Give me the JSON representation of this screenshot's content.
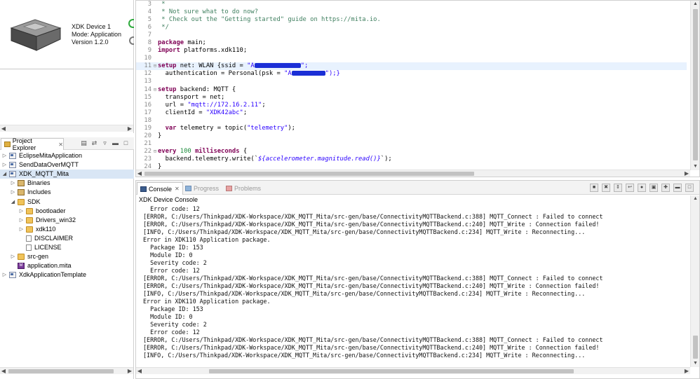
{
  "device": {
    "name": "XDK Device 1",
    "mode": "Mode: Application",
    "version": "Version 1.2.0"
  },
  "project_explorer": {
    "tab_label": "Project Explorer",
    "close_glyph": "✕",
    "items": [
      {
        "label": "EclipseMitaApplication",
        "icon": "project-icon",
        "expanded": false
      },
      {
        "label": "SendDataOverMQTT",
        "icon": "project-icon",
        "expanded": false
      },
      {
        "label": "XDK_MQTT_Mita",
        "icon": "project-icon",
        "expanded": true,
        "selected": true
      },
      {
        "label": "Binaries",
        "icon": "binaries-icon",
        "expanded": false
      },
      {
        "label": "Includes",
        "icon": "includes-icon",
        "expanded": false
      },
      {
        "label": "SDK",
        "icon": "folder-icon",
        "expanded": true
      },
      {
        "label": "bootloader",
        "icon": "folder-icon",
        "expanded": false
      },
      {
        "label": "Drivers_win32",
        "icon": "folder-icon",
        "expanded": false
      },
      {
        "label": "xdk110",
        "icon": "folder-icon",
        "expanded": false
      },
      {
        "label": "DISCLAIMER",
        "icon": "file-icon"
      },
      {
        "label": "LICENSE",
        "icon": "file-icon"
      },
      {
        "label": "src-gen",
        "icon": "folder-icon",
        "expanded": false
      },
      {
        "label": "application.mita",
        "icon": "mita-file-icon"
      },
      {
        "label": "XdkApplicationTemplate",
        "icon": "project-icon",
        "expanded": false
      }
    ]
  },
  "editor": {
    "lines": [
      {
        "n": "3",
        "text": " *"
      },
      {
        "n": "4",
        "text": " * Not sure what to do now?"
      },
      {
        "n": "5",
        "text": " * Check out the \"Getting started\" guide on https://mita.io."
      },
      {
        "n": "6",
        "text": " */"
      },
      {
        "n": "7",
        "text": ""
      },
      {
        "n": "8",
        "text": "package main;"
      },
      {
        "n": "9",
        "text": "import platforms.xdk110;"
      },
      {
        "n": "10",
        "text": ""
      },
      {
        "n": "11",
        "text": "setup net: WLAN {ssid = \"A"
      },
      {
        "n": "12",
        "text": "  authentication = Personal(psk = \"A"
      },
      {
        "n": "13",
        "text": ""
      },
      {
        "n": "14",
        "text": "setup backend: MQTT {"
      },
      {
        "n": "15",
        "text": "  transport = net;"
      },
      {
        "n": "16",
        "text": "  url = \"mqtt://172.16.2.11\";"
      },
      {
        "n": "17",
        "text": "  clientId = \"XDK42abc\";"
      },
      {
        "n": "18",
        "text": ""
      },
      {
        "n": "19",
        "text": "  var telemetry = topic(\"telemetry\");"
      },
      {
        "n": "20",
        "text": "}"
      },
      {
        "n": "21",
        "text": ""
      },
      {
        "n": "22",
        "text": "every 100 milliseconds {"
      },
      {
        "n": "23",
        "text": "  backend.telemetry.write(`${accelerometer.magnitude.read()}`);"
      },
      {
        "n": "24",
        "text": "}"
      }
    ],
    "tokens": {
      "kw_setup": "setup",
      "kw_package": "package",
      "kw_import": "import",
      "kw_var": "var",
      "kw_every": "every",
      "num_100": "100",
      "kw_milliseconds": "milliseconds",
      "line11_rest": " net: WLAN {ssid = ",
      "line11_str_open": "\"A",
      "line11_str_close": "\";",
      "line12_pre": "  authentication = Personal(psk = ",
      "line12_str_open": "\"A",
      "line12_str_close": "\");}",
      "line3": " *",
      "line4": " * Not sure what to do now?",
      "line5": " * Check out the \"Getting started\" guide on https://mita.io.",
      "line6": " */",
      "line8_rest": " main;",
      "line9_rest": " platforms.xdk110;",
      "line14_rest": " backend: MQTT {",
      "line15": "  transport = net;",
      "line16_pre": "  url = ",
      "line16_str": "\"mqtt://172.16.2.11\"",
      "line16_post": ";",
      "line17_pre": "  clientId = ",
      "line17_str": "\"XDK42abc\"",
      "line17_post": ";",
      "line19_pre": "  ",
      "line19_mid": " telemetry = topic(",
      "line19_str": "\"telemetry\"",
      "line19_post": ");",
      "line20": "}",
      "line22_post": " {",
      "line23_pre": "  backend.telemetry.write(`",
      "line23_tpl": "${accelerometer.magnitude.read()}",
      "line23_post": "`);",
      "line24": "}"
    }
  },
  "console": {
    "tabs": [
      {
        "label": "Console",
        "active": true
      },
      {
        "label": "Progress",
        "active": false
      },
      {
        "label": "Problems",
        "active": false
      }
    ],
    "title": "XDK Device Console",
    "lines": [
      "  Error code: 12",
      "[ERROR, C:/Users/Thinkpad/XDK-Workspace/XDK_MQTT_Mita/src-gen/base/ConnectivityMQTTBackend.c:388] MQTT_Connect : Failed to connect",
      "[ERROR, C:/Users/Thinkpad/XDK-Workspace/XDK_MQTT_Mita/src-gen/base/ConnectivityMQTTBackend.c:240] MQTT_Write : Connection failed!",
      "[INFO, C:/Users/Thinkpad/XDK-Workspace/XDK_MQTT_Mita/src-gen/base/ConnectivityMQTTBackend.c:234] MQTT_Write : Reconnecting...",
      "Error in XDK110 Application package.",
      "  Package ID: 153",
      "  Module ID: 0",
      "  Severity code: 2",
      "  Error code: 12",
      "[ERROR, C:/Users/Thinkpad/XDK-Workspace/XDK_MQTT_Mita/src-gen/base/ConnectivityMQTTBackend.c:388] MQTT_Connect : Failed to connect",
      "[ERROR, C:/Users/Thinkpad/XDK-Workspace/XDK_MQTT_Mita/src-gen/base/ConnectivityMQTTBackend.c:240] MQTT_Write : Connection failed!",
      "[INFO, C:/Users/Thinkpad/XDK-Workspace/XDK_MQTT_Mita/src-gen/base/ConnectivityMQTTBackend.c:234] MQTT_Write : Reconnecting...",
      "Error in XDK110 Application package.",
      "  Package ID: 153",
      "  Module ID: 0",
      "  Severity code: 2",
      "  Error code: 12",
      "[ERROR, C:/Users/Thinkpad/XDK-Workspace/XDK_MQTT_Mita/src-gen/base/ConnectivityMQTTBackend.c:388] MQTT_Connect : Failed to connect",
      "[ERROR, C:/Users/Thinkpad/XDK-Workspace/XDK_MQTT_Mita/src-gen/base/ConnectivityMQTTBackend.c:240] MQTT_Write : Connection failed!",
      "[INFO, C:/Users/Thinkpad/XDK-Workspace/XDK_MQTT_Mita/src-gen/base/ConnectivityMQTTBackend.c:234] MQTT_Write : Reconnecting..."
    ]
  },
  "colors": {
    "selection": "#d9e6f5",
    "keyword": "#7f0055",
    "string": "#2a00ff",
    "comment": "#3f7f5f",
    "redaction": "#1b2fd6",
    "status_ok": "#2eaa3c"
  }
}
